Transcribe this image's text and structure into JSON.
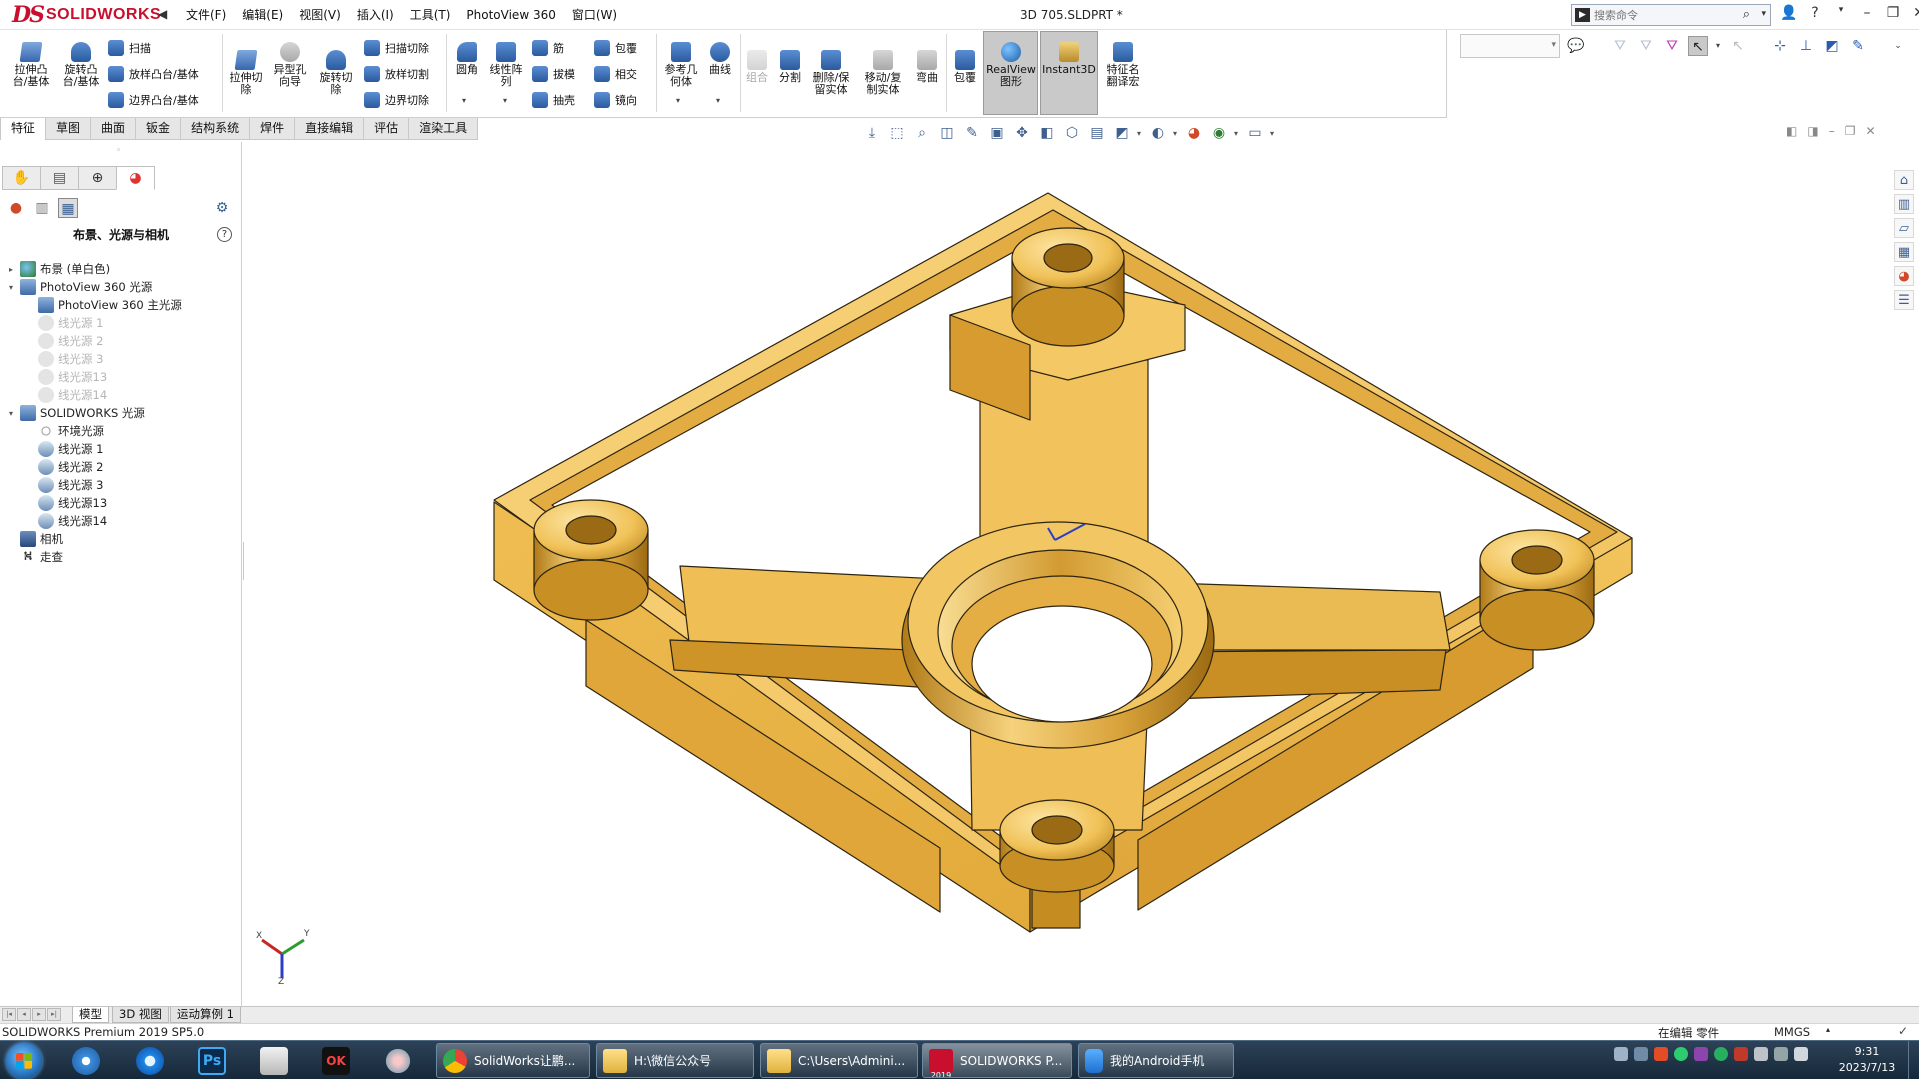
{
  "app": {
    "logo_ds": "DS",
    "logo_name": "SOLIDWORKS",
    "doc_title": "3D 705.SLDPRT *",
    "menu": [
      "文件(F)",
      "编辑(E)",
      "视图(V)",
      "插入(I)",
      "工具(T)",
      "PhotoView 360",
      "窗口(W)"
    ],
    "search_placeholder": "搜索命令"
  },
  "toolbar": {
    "big_buttons": [
      {
        "label1": "拉伸凸",
        "label2": "台/基体"
      },
      {
        "label1": "旋转凸",
        "label2": "台/基体"
      }
    ],
    "loft_group": [
      "扫描",
      "放样凸台/基体",
      "边界凸台/基体"
    ],
    "cut_buttons": [
      {
        "label1": "拉伸切",
        "label2": "除"
      },
      {
        "label1": "异型孔",
        "label2": "向导"
      },
      {
        "label1": "旋转切",
        "label2": "除"
      }
    ],
    "cut_group": [
      "扫描切除",
      "放样切割",
      "边界切除"
    ],
    "fillet": "圆角",
    "pattern": {
      "label1": "线性阵",
      "label2": "列"
    },
    "feature_group1": [
      "筋",
      "拔模",
      "抽壳"
    ],
    "feature_group2": [
      "包覆",
      "相交",
      "镜向"
    ],
    "refgeom": {
      "label1": "参考几",
      "label2": "何体"
    },
    "curves": "曲线",
    "combine": "组合",
    "split": "分割",
    "delete_body": {
      "label1": "删除/保",
      "label2": "留实体"
    },
    "move_body": {
      "label1": "移动/复",
      "label2": "制实体"
    },
    "flex": "弯曲",
    "wrap": "包覆",
    "realview": {
      "label1": "RealView",
      "label2": "图形"
    },
    "instant3d": "Instant3D",
    "translate": {
      "label1": "特征名",
      "label2": "翻译宏"
    }
  },
  "cmd_tabs": [
    "特征",
    "草图",
    "曲面",
    "钣金",
    "结构系统",
    "焊件",
    "直接编辑",
    "评估",
    "渲染工具"
  ],
  "left_pane": {
    "title": "布景、光源与相机",
    "help": "?",
    "tree": [
      {
        "label": "布景 (单白色)",
        "level": 0,
        "toggle": "▸",
        "icon": "scene",
        "disabled": false
      },
      {
        "label": "PhotoView 360 光源",
        "level": 0,
        "toggle": "▾",
        "icon": "pv",
        "disabled": false
      },
      {
        "label": "PhotoView 360 主光源",
        "level": 1,
        "toggle": "",
        "icon": "pv",
        "disabled": false
      },
      {
        "label": "线光源 1",
        "level": 1,
        "toggle": "",
        "icon": "lightdis",
        "disabled": true
      },
      {
        "label": "线光源 2",
        "level": 1,
        "toggle": "",
        "icon": "lightdis",
        "disabled": true
      },
      {
        "label": "线光源 3",
        "level": 1,
        "toggle": "",
        "icon": "lightdis",
        "disabled": true
      },
      {
        "label": "线光源13",
        "level": 1,
        "toggle": "",
        "icon": "lightdis",
        "disabled": true
      },
      {
        "label": "线光源14",
        "level": 1,
        "toggle": "",
        "icon": "lightdis",
        "disabled": true
      },
      {
        "label": "SOLIDWORKS 光源",
        "level": 0,
        "toggle": "▾",
        "icon": "pv",
        "disabled": false
      },
      {
        "label": "环境光源",
        "level": 1,
        "toggle": "",
        "icon": "bulb",
        "disabled": false
      },
      {
        "label": "线光源 1",
        "level": 1,
        "toggle": "",
        "icon": "light",
        "disabled": false
      },
      {
        "label": "线光源 2",
        "level": 1,
        "toggle": "",
        "icon": "light",
        "disabled": false
      },
      {
        "label": "线光源 3",
        "level": 1,
        "toggle": "",
        "icon": "light",
        "disabled": false
      },
      {
        "label": "线光源13",
        "level": 1,
        "toggle": "",
        "icon": "light",
        "disabled": false
      },
      {
        "label": "线光源14",
        "level": 1,
        "toggle": "",
        "icon": "light",
        "disabled": false
      },
      {
        "label": "相机",
        "level": 0,
        "toggle": "",
        "icon": "cam",
        "disabled": false
      },
      {
        "label": "走查",
        "level": 0,
        "toggle": "",
        "icon": "walk",
        "disabled": false
      }
    ]
  },
  "model_tabs": [
    "模型",
    "3D 视图",
    "运动算例 1"
  ],
  "status": {
    "left": "SOLIDWORKS Premium 2019 SP5.0",
    "editing": "在编辑 零件",
    "units": "MMGS"
  },
  "taskbar": {
    "windows": [
      "SolidWorks让鹏...",
      "H:\\微信公众号",
      "C:\\Users\\Admini...",
      "SOLIDWORKS P...",
      "我的Android手机"
    ],
    "sw_badge": "2019",
    "clock_time": "9:31",
    "clock_date": "2023/7/13"
  },
  "colors": {
    "part_light": "#F6CB6A",
    "part_mid": "#E9B748",
    "part_dark": "#C8921F",
    "brand_red": "#C8102E"
  }
}
